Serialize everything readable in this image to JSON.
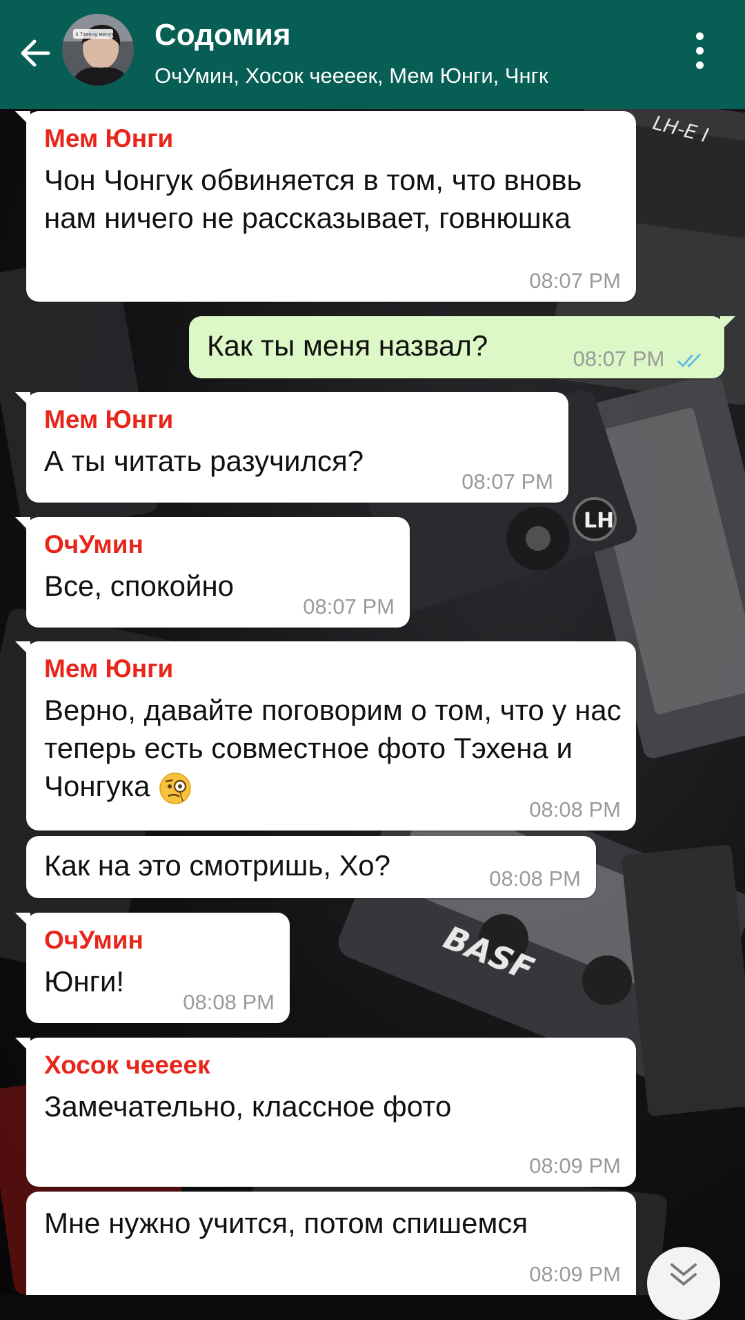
{
  "header": {
    "title": "Содомия",
    "members": "ОчУмин, Хосок чеееек, Мем Юнги, Чнгк",
    "avatar_caption": "Х Тэхену мечут"
  },
  "messages": [
    {
      "sender": "Мем Юнги",
      "text": "Чон Чонгук обвиняется в том, что вновь нам ничего не рассказывает, говнюшка",
      "time": "08:07 PM",
      "direction": "in"
    },
    {
      "sender": "",
      "text": "Как ты меня назвал?",
      "time": "08:07 PM",
      "direction": "out",
      "status": "read"
    },
    {
      "sender": "Мем Юнги",
      "text": "А ты читать разучился?",
      "time": "08:07 PM",
      "direction": "in"
    },
    {
      "sender": "ОчУмин",
      "text": "Все, спокойно",
      "time": "08:07 PM",
      "direction": "in"
    },
    {
      "sender": "Мем Юнги",
      "text": "Верно, давайте поговорим о том, что у нас теперь есть совместное фото Тэхена и Чонгука",
      "emoji": "face-with-monocle",
      "time": "08:08 PM",
      "direction": "in"
    },
    {
      "sender": "",
      "text": "Как на это смотришь, Хо?",
      "time": "08:08 PM",
      "direction": "in"
    },
    {
      "sender": "ОчУмин",
      "text": "Юнги!",
      "time": "08:08 PM",
      "direction": "in"
    },
    {
      "sender": "Хосок чеееек",
      "text": "Замечательно, классное фото",
      "time": "08:09 PM",
      "direction": "in"
    },
    {
      "sender": "",
      "text": "Мне нужно учится, потом спишемся",
      "time": "08:09 PM",
      "direction": "in"
    }
  ],
  "colors": {
    "header": "#075e54",
    "incoming_bubble": "#ffffff",
    "outgoing_bubble": "#dcf8c6",
    "sender_name": "#e8251b",
    "timestamp": "#9a9a9a",
    "read_ticks": "#4fb6ec"
  },
  "icons": {
    "back": "arrow-left-icon",
    "menu": "more-vertical-icon",
    "read_status": "double-check-icon",
    "scroll_down": "chevron-double-down-icon"
  },
  "background": {
    "watermark_labels": [
      "LH-E I",
      "LH",
      "BASF"
    ]
  }
}
